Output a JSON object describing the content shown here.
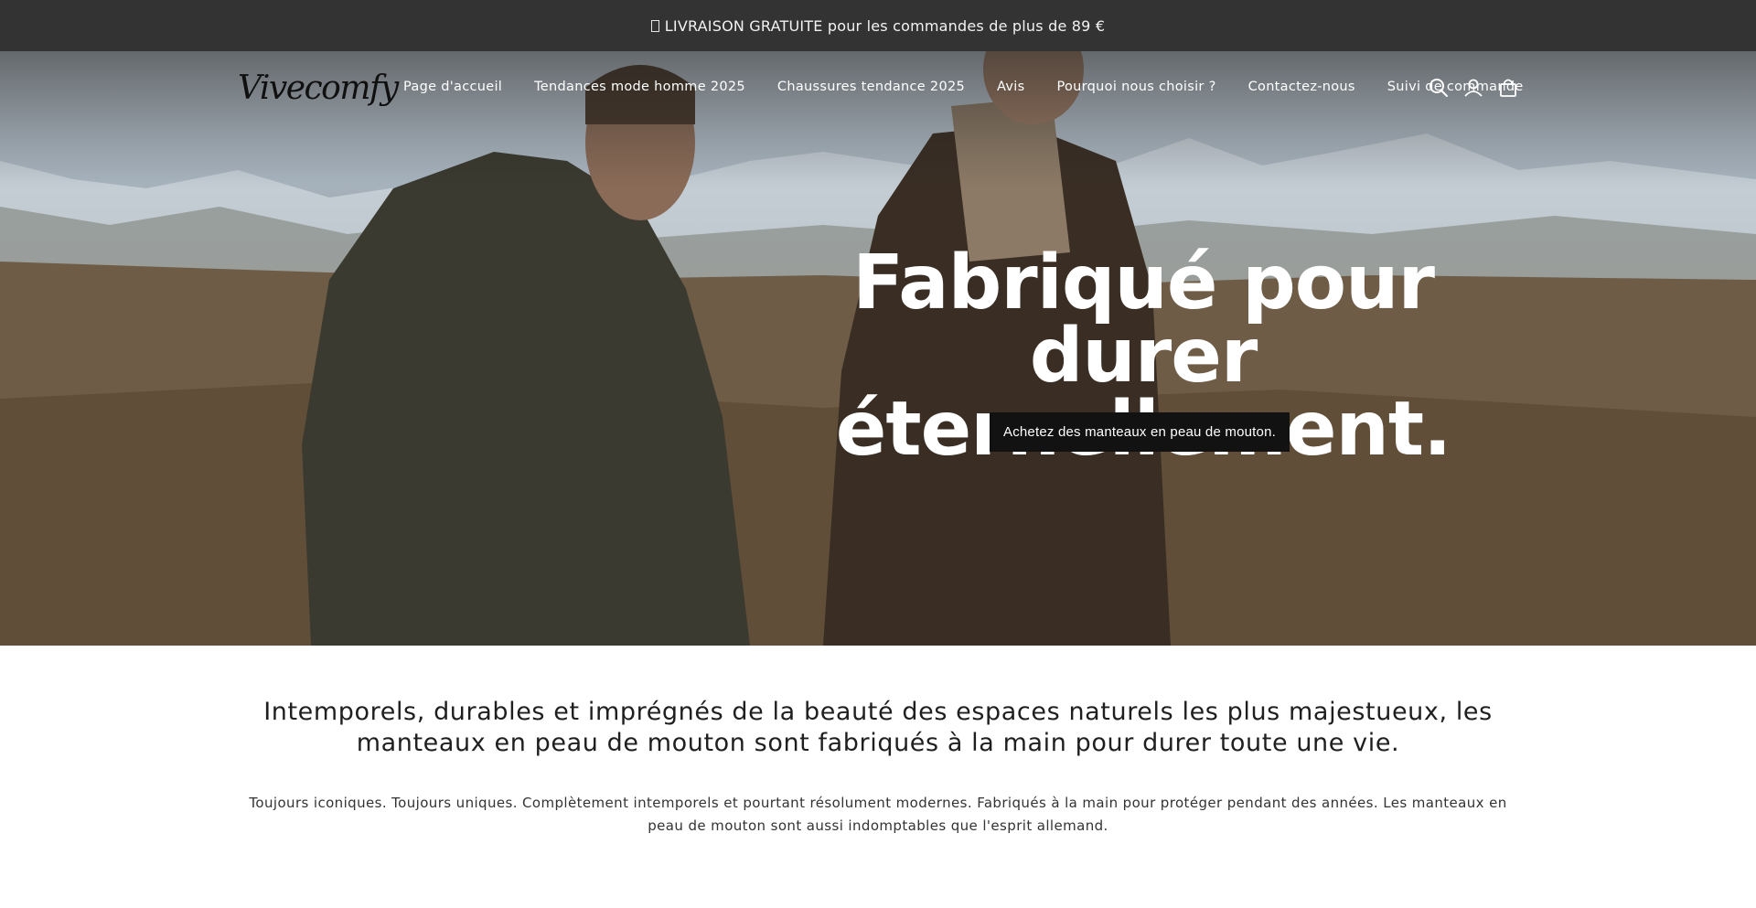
{
  "announcement": {
    "icon": "box-icon",
    "text": "LIVRAISON GRATUITE pour les commandes de plus de 89 €"
  },
  "header": {
    "logo_text": "Vivecomfy",
    "nav": [
      "Page d'accueil",
      "Tendances mode homme 2025",
      "Chaussures tendance 2025",
      "Avis",
      "Pourquoi nous choisir ?",
      "Contactez-nous",
      "Suivi de commande"
    ],
    "icons": [
      "search-icon",
      "account-icon",
      "cart-icon"
    ]
  },
  "hero": {
    "title_line1": "Fabriqué pour durer",
    "title_line2": "éternellement.",
    "cta_label": "Achetez des manteaux en peau de mouton."
  },
  "intro": {
    "lead": "Intemporels, durables et imprégnés de la beauté des espaces naturels les plus majestueux, les manteaux en peau de mouton sont fabriqués à la main pour durer toute une vie.",
    "body": "Toujours iconiques. Toujours uniques. Complètement intemporels et pourtant résolument modernes. Fabriqués à la main pour protéger pendant des années. Les manteaux en peau de mouton sont aussi indomptables que l'esprit allemand."
  },
  "colors": {
    "announcement_bg": "#333333",
    "cta_bg": "#121212",
    "text": "#1f1f1f"
  }
}
